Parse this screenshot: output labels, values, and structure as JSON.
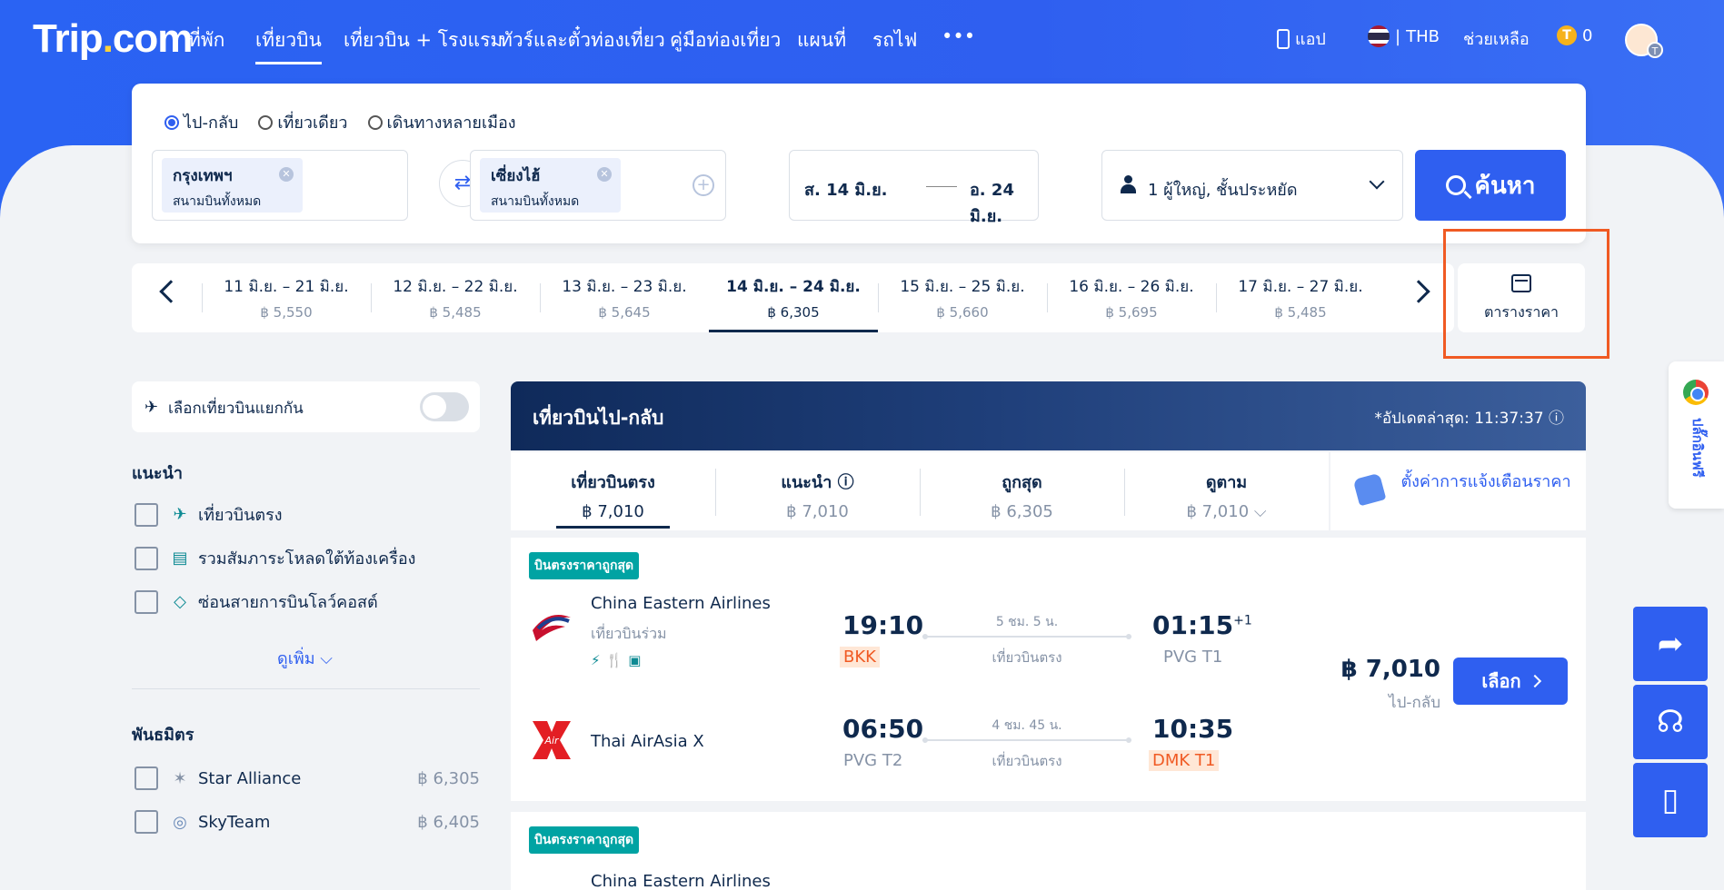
{
  "brand": {
    "logo_left": "Trip",
    "logo_dot": ".",
    "logo_right": "com"
  },
  "nav": {
    "items": [
      "ที่พัก",
      "เที่ยวบิน",
      "เที่ยวบิน + โรงแรม",
      "ทัวร์และตั๋วท่องเที่ยว",
      "คู่มือท่องเที่ยว",
      "แผนที่",
      "รถไฟ",
      "•••"
    ],
    "app": "แอป",
    "currency": "THB",
    "help": "ช่วยเหลือ",
    "coins": "0",
    "coin_symbol": "T",
    "avatar_badge": "T"
  },
  "search": {
    "trip_types": [
      "ไป-กลับ",
      "เที่ยวเดียว",
      "เดินทางหลายเมือง"
    ],
    "origin": {
      "city": "กรุงเทพฯ",
      "airport": "สนามบินทั้งหมด"
    },
    "destination": {
      "city": "เซี่ยงไฮ้",
      "airport": "สนามบินทั้งหมด"
    },
    "depart": "ส. 14 มิ.ย.",
    "return": "อ. 24 มิ.ย.",
    "passengers": "1 ผู้ใหญ่, ชั้นประหยัด",
    "button": "ค้นหา"
  },
  "date_strip": [
    {
      "range": "11 มิ.ย. – 21 มิ.ย.",
      "price": "฿ 5,550"
    },
    {
      "range": "12 มิ.ย. – 22 มิ.ย.",
      "price": "฿ 5,485"
    },
    {
      "range": "13 มิ.ย. – 23 มิ.ย.",
      "price": "฿ 5,645"
    },
    {
      "range": "14 มิ.ย. – 24 มิ.ย.",
      "price": "฿ 6,305"
    },
    {
      "range": "15 มิ.ย. – 25 มิ.ย.",
      "price": "฿ 5,660"
    },
    {
      "range": "16 มิ.ย. – 26 มิ.ย.",
      "price": "฿ 5,695"
    },
    {
      "range": "17 มิ.ย. – 27 มิ.ย.",
      "price": "฿ 5,485"
    }
  ],
  "price_calendar": "ตารางราคา",
  "filters": {
    "separate": "เลือกเที่ยวบินแยกกัน",
    "recommend_title": "แนะนำ",
    "recommend": [
      "เที่ยวบินตรง",
      "รวมสัมภาระโหลดใต้ท้องเครื่อง",
      "ซ่อนสายการบินโลว์คอสต์"
    ],
    "more": "ดูเพิ่ม",
    "alliance_title": "พันธมิตร",
    "alliances": [
      {
        "name": "Star Alliance",
        "price": "฿ 6,305"
      },
      {
        "name": "SkyTeam",
        "price": "฿ 6,405"
      }
    ]
  },
  "results": {
    "title": "เที่ยวบินไป-กลับ",
    "updated": "*อัปเดตล่าสุด: 11:37:37 ⓘ",
    "tabs": [
      {
        "label": "เที่ยวบินตรง",
        "price": "฿ 7,010"
      },
      {
        "label": "แนะนำ ⓘ",
        "price": "฿ 7,010"
      },
      {
        "label": "ถูกสุด",
        "price": "฿ 6,305"
      },
      {
        "label": "ดูตาม",
        "price": "฿ 7,010 ⌵"
      }
    ],
    "alert": "ตั้งค่าการแจ้งเตือนราคา",
    "cards": [
      {
        "tag": "บินตรงราคาถูกสุด",
        "out": {
          "airline": "China Eastern Airlines",
          "sub": "เที่ยวบินร่วม",
          "amenities": "⚡🍴▣",
          "dep": "19:10",
          "dep_apt": "BKK",
          "dur": "5 ชม. 5 น.",
          "type": "เที่ยวบินตรง",
          "arr": "01:15",
          "arr_plus": "+1",
          "arr_apt": "PVG T1"
        },
        "ret": {
          "airline": "Thai AirAsia X",
          "dep": "06:50",
          "dep_apt": "PVG T2",
          "dur": "4 ชม. 45 น.",
          "type": "เที่ยวบินตรง",
          "arr": "10:35",
          "arr_apt": "DMK T1"
        },
        "price": "฿ 7,010",
        "price_type": "ไป-กลับ",
        "button": "เลือก"
      },
      {
        "tag": "บินตรงราคาถูกสุด",
        "out": {
          "airline": "China Eastern Airlines"
        }
      }
    ]
  },
  "side": {
    "chrome": "ปลั๊กอินฟรี",
    "share": "➦",
    "support": "☊",
    "mobile": "▯"
  }
}
